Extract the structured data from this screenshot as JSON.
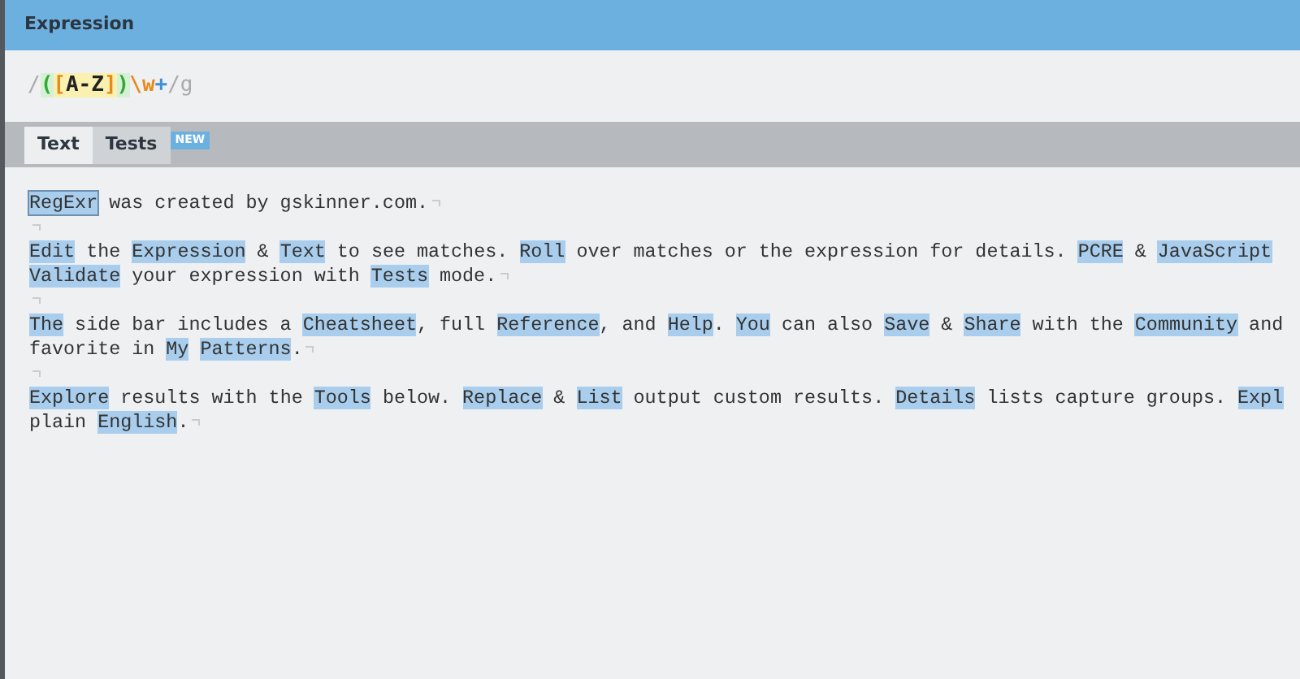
{
  "panel": {
    "title": "Expression"
  },
  "expression": {
    "tokens": [
      {
        "text": "/",
        "kind": "delimiter"
      },
      {
        "text": "(",
        "kind": "group"
      },
      {
        "text": "[",
        "kind": "set"
      },
      {
        "text": "A-Z",
        "kind": "range"
      },
      {
        "text": "]",
        "kind": "set"
      },
      {
        "text": ")",
        "kind": "group"
      },
      {
        "text": "\\w",
        "kind": "escape"
      },
      {
        "text": "+",
        "kind": "quantifier"
      },
      {
        "text": "/g",
        "kind": "delimiter"
      }
    ]
  },
  "tabs": [
    {
      "label": "Text",
      "selected": true
    },
    {
      "label": "Tests",
      "selected": false,
      "badge": "NEW"
    }
  ],
  "text_lines": [
    {
      "kind": "text",
      "wrapped": false,
      "segments": [
        {
          "text": "RegExr",
          "match": true,
          "hovered": true
        },
        {
          "text": " was created by gskinner.com.",
          "match": false
        }
      ]
    },
    {
      "kind": "empty",
      "wrapped": false
    },
    {
      "kind": "text",
      "wrapped": true,
      "segments": [
        {
          "text": "Edit",
          "match": true
        },
        {
          "text": " the ",
          "match": false
        },
        {
          "text": "Expression",
          "match": true
        },
        {
          "text": " & ",
          "match": false
        },
        {
          "text": "Text",
          "match": true
        },
        {
          "text": " to see matches. ",
          "match": false
        },
        {
          "text": "Roll",
          "match": true
        },
        {
          "text": " over matches or the expression for details. ",
          "match": false
        },
        {
          "text": "PCRE",
          "match": true
        },
        {
          "text": " & ",
          "match": false
        },
        {
          "text": "JavaScript",
          "match": true
        }
      ]
    },
    {
      "kind": "text",
      "wrapped": false,
      "segments": [
        {
          "text": "Validate",
          "match": true
        },
        {
          "text": " your expression with ",
          "match": false
        },
        {
          "text": "Tests",
          "match": true
        },
        {
          "text": " mode.",
          "match": false
        }
      ]
    },
    {
      "kind": "empty",
      "wrapped": false
    },
    {
      "kind": "text",
      "wrapped": true,
      "segments": [
        {
          "text": "The",
          "match": true
        },
        {
          "text": " side bar includes a ",
          "match": false
        },
        {
          "text": "Cheatsheet",
          "match": true
        },
        {
          "text": ", full ",
          "match": false
        },
        {
          "text": "Reference",
          "match": true
        },
        {
          "text": ", and ",
          "match": false
        },
        {
          "text": "Help",
          "match": true
        },
        {
          "text": ". ",
          "match": false
        },
        {
          "text": "You",
          "match": true
        },
        {
          "text": " can also ",
          "match": false
        },
        {
          "text": "Save",
          "match": true
        },
        {
          "text": " & ",
          "match": false
        },
        {
          "text": "Share",
          "match": true
        },
        {
          "text": " with the ",
          "match": false
        },
        {
          "text": "Community",
          "match": true
        },
        {
          "text": " and",
          "match": false
        }
      ]
    },
    {
      "kind": "text",
      "wrapped": false,
      "segments": [
        {
          "text": "favorite in ",
          "match": false
        },
        {
          "text": "My",
          "match": true
        },
        {
          "text": "Patterns",
          "match": true,
          "space_before": true
        },
        {
          "text": ".",
          "match": false
        }
      ]
    },
    {
      "kind": "empty",
      "wrapped": false
    },
    {
      "kind": "text",
      "wrapped": true,
      "segments": [
        {
          "text": "Explore",
          "match": true
        },
        {
          "text": " results with the ",
          "match": false
        },
        {
          "text": "Tools",
          "match": true
        },
        {
          "text": " below. ",
          "match": false
        },
        {
          "text": "Replace",
          "match": true
        },
        {
          "text": " & ",
          "match": false
        },
        {
          "text": "List",
          "match": true
        },
        {
          "text": " output custom results. ",
          "match": false
        },
        {
          "text": "Details",
          "match": true
        },
        {
          "text": " lists capture groups. ",
          "match": false
        },
        {
          "text": "Expl",
          "match": true
        }
      ]
    },
    {
      "kind": "text",
      "wrapped": false,
      "segments": [
        {
          "text": "plain ",
          "match": false
        },
        {
          "text": "English",
          "match": true
        },
        {
          "text": ".",
          "match": false
        }
      ]
    }
  ]
}
